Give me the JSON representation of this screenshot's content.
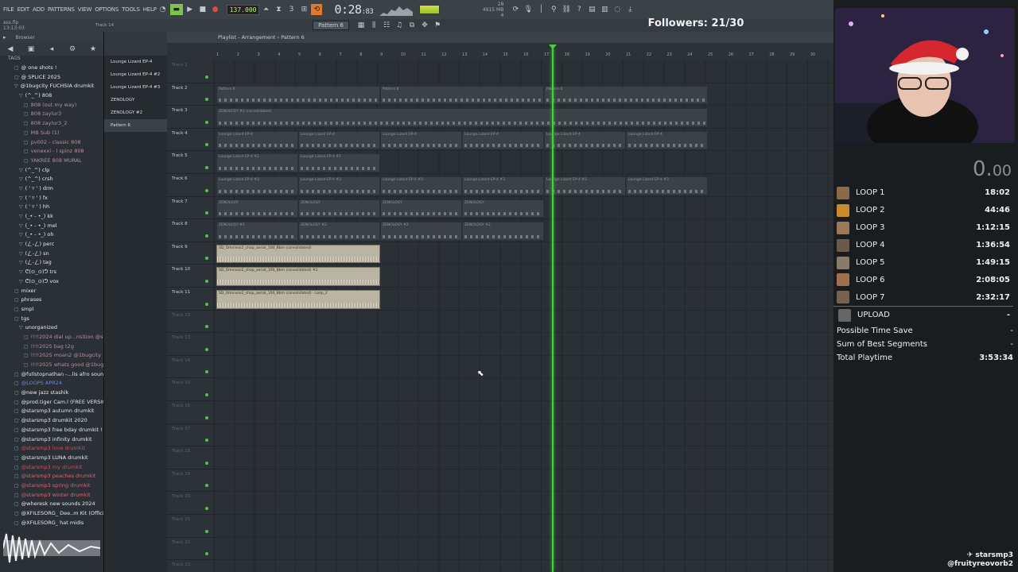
{
  "menu": [
    "FILE",
    "EDIT",
    "ADD",
    "PATTERNS",
    "VIEW",
    "OPTIONS",
    "TOOLS",
    "HELP"
  ],
  "toolbar": {
    "tempo": "137.000",
    "song_time": "0:28",
    "song_time_small": ":83",
    "memory_top": "4915 MB",
    "memory_bottom": "4",
    "cpu_value": "28"
  },
  "hint": {
    "file": "ass.flp",
    "time": "13:13:03",
    "track": "Track 14",
    "pattern": "Pattern 6",
    "snap": "Line"
  },
  "browser": {
    "title": "Browser",
    "tags_label": "TAGS",
    "items": [
      {
        "label": "@ one shots !",
        "color": "white",
        "fold": "▢"
      },
      {
        "label": "@ SPLICE 2025",
        "color": "white",
        "fold": "▢"
      },
      {
        "label": "@1bugcity FUCHSIA drumkit",
        "color": "white",
        "fold": "▽"
      },
      {
        "label": "(^_^) 808",
        "color": "white",
        "fold": "▽"
      },
      {
        "label": "808 (out my way)",
        "color": "dim",
        "fold": "▢"
      },
      {
        "label": "808 zaylur3",
        "color": "dim",
        "fold": "▢"
      },
      {
        "label": "808 zaylur3_2",
        "color": "dim",
        "fold": "▢"
      },
      {
        "label": "MB Sub (1)",
        "color": "dim",
        "fold": "▢"
      },
      {
        "label": "pv002 - classic 808",
        "color": "dim",
        "fold": "▢"
      },
      {
        "label": "venexxi - l spinz 808",
        "color": "dim",
        "fold": "▢"
      },
      {
        "label": "YAKREE 808 MURAL",
        "color": "dim",
        "fold": "▢"
      },
      {
        "label": "(^_^) clp",
        "color": "white",
        "fold": "▽"
      },
      {
        "label": "(^_^) crsh",
        "color": "white",
        "fold": "▽"
      },
      {
        "label": "( ' ▿ ' ) drm",
        "color": "white",
        "fold": "▽"
      },
      {
        "label": "( ' ▿ ' ) fx",
        "color": "white",
        "fold": "▽"
      },
      {
        "label": "( ' ▿ ' ) hh",
        "color": "white",
        "fold": "▽"
      },
      {
        "label": "(_• - •_) kk",
        "color": "white",
        "fold": "▽"
      },
      {
        "label": "(_• - •_) mel",
        "color": "white",
        "fold": "▽"
      },
      {
        "label": "(_• - •_) oh",
        "color": "white",
        "fold": "▽"
      },
      {
        "label": "(ㄥ-ㄥ) perc",
        "color": "white",
        "fold": "▽"
      },
      {
        "label": "(ㄥ-ㄥ) sn",
        "color": "white",
        "fold": "▽"
      },
      {
        "label": "(ㄥ-ㄥ) tag",
        "color": "white",
        "fold": "▽"
      },
      {
        "label": "ᕦ(⊙_⊙)ᕤ trs",
        "color": "white",
        "fold": "▽"
      },
      {
        "label": "ᕦ(⊙_⊙)ᕤ vox",
        "color": "white",
        "fold": "▽"
      },
      {
        "label": "mixer",
        "color": "white",
        "fold": "▢"
      },
      {
        "label": "phrases",
        "color": "white",
        "fold": "▢"
      },
      {
        "label": "smpl",
        "color": "white",
        "fold": "▢"
      },
      {
        "label": "tgs",
        "color": "white",
        "fold": "▢"
      },
      {
        "label": "unorganized",
        "color": "white",
        "fold": "▽"
      },
      {
        "label": "!!!!2024 dial up...nsition @starsmp3",
        "color": "dim",
        "fold": "▢"
      },
      {
        "label": "!!!!2025 bag t2g",
        "color": "dim",
        "fold": "▢"
      },
      {
        "label": "!!!!2025 moan2 @1bugcity",
        "color": "dim",
        "fold": "▢"
      },
      {
        "label": "!!!!2025 whats good @1bugcity",
        "color": "dim",
        "fold": "▢"
      },
      {
        "label": "@fullstopnathan -...lis afro sound kit",
        "color": "white",
        "fold": "▢"
      },
      {
        "label": "@LOOPS APR24",
        "color": "blue",
        "fold": "▢"
      },
      {
        "label": "@new jazz stashik",
        "color": "white",
        "fold": "▢"
      },
      {
        "label": "@prod.tiger Cam.l (FREE VERSION)",
        "color": "white",
        "fold": "▢"
      },
      {
        "label": "@starsmp3 autumn drumkit",
        "color": "white",
        "fold": "▢"
      },
      {
        "label": "@starsmp3 drumkit 2020",
        "color": "white",
        "fold": "▢"
      },
      {
        "label": "@starsmp3 free bday drumkit !",
        "color": "white",
        "fold": "▢"
      },
      {
        "label": "@starsmp3 infinity drumkit",
        "color": "white",
        "fold": "▢"
      },
      {
        "label": "@starsmp3 love drumkit",
        "color": "red",
        "fold": "▢"
      },
      {
        "label": "@starsmp3 LUNA drumkit",
        "color": "white",
        "fold": "▢"
      },
      {
        "label": "@starsmp3 my drumkit",
        "color": "red",
        "fold": "▢"
      },
      {
        "label": "@starsmp3 peaches drumkit",
        "color": "pink",
        "fold": "▢"
      },
      {
        "label": "@starsmp3 spring drumkit",
        "color": "pink",
        "fold": "▢"
      },
      {
        "label": "@starsmp3 winter drumkit",
        "color": "pink",
        "fold": "▢"
      },
      {
        "label": "@wheresk new sounds 2024",
        "color": "white",
        "fold": "▢"
      },
      {
        "label": "@XFILESORG_ Dee..m Kit (Official)",
        "color": "white",
        "fold": "▢"
      },
      {
        "label": "@XFILESORG_ hat midis",
        "color": "white",
        "fold": "▢"
      }
    ]
  },
  "picker": {
    "items": [
      "Lounge Lizard EP-4",
      "Lounge Lizard EP-4 #2",
      "Lounge Lizard EP-4 #3",
      "ZENOLOGY",
      "ZENOLOGY #2",
      "Pattern 6"
    ]
  },
  "playlist": {
    "title": "Playlist - Arrangement › Pattern 6",
    "bar_numbers": [
      "1",
      "2",
      "3",
      "4",
      "5",
      "6",
      "7",
      "8",
      "9",
      "10",
      "11",
      "12",
      "13",
      "14",
      "15",
      "16",
      "17",
      "18",
      "19",
      "20",
      "21",
      "22",
      "23",
      "24",
      "25",
      "26",
      "27",
      "28",
      "29",
      "30"
    ],
    "tracks": [
      "Track 1",
      "Track 2",
      "Track 3",
      "Track 4",
      "Track 5",
      "Track 6",
      "Track 7",
      "Track 8",
      "Track 9",
      "Track 10",
      "Track 11",
      "Track 12",
      "Track 13",
      "Track 14",
      "Track 15",
      "Track 16",
      "Track 17",
      "Track 18",
      "Track 19",
      "Track 20",
      "Track 21",
      "Track 22",
      "Track 23"
    ],
    "clips": [
      {
        "track": 1,
        "start": 0,
        "length": 8,
        "label": "Pattern 6",
        "kind": "pattern"
      },
      {
        "track": 1,
        "start": 8,
        "length": 8,
        "label": "Pattern 6",
        "kind": "pattern"
      },
      {
        "track": 1,
        "start": 16,
        "length": 8,
        "label": "Pattern 6",
        "kind": "pattern"
      },
      {
        "track": 2,
        "start": 0,
        "length": 24,
        "label": "ZENOLOGY #2 (consolidated)",
        "kind": "pattern"
      },
      {
        "track": 3,
        "start": 0,
        "length": 4,
        "label": "Lounge Lizard EP-4",
        "kind": "pattern"
      },
      {
        "track": 3,
        "start": 4,
        "length": 4,
        "label": "Lounge Lizard EP-4",
        "kind": "pattern"
      },
      {
        "track": 3,
        "start": 8,
        "length": 4,
        "label": "Lounge Lizard EP-4",
        "kind": "pattern"
      },
      {
        "track": 3,
        "start": 12,
        "length": 4,
        "label": "Lounge Lizard EP-4",
        "kind": "pattern"
      },
      {
        "track": 3,
        "start": 16,
        "length": 4,
        "label": "Lounge Lizard EP-4",
        "kind": "pattern"
      },
      {
        "track": 3,
        "start": 20,
        "length": 4,
        "label": "Lounge Lizard EP-4",
        "kind": "pattern"
      },
      {
        "track": 4,
        "start": 0,
        "length": 4,
        "label": "Lounge Lizard EP-4 #2",
        "kind": "pattern"
      },
      {
        "track": 4,
        "start": 4,
        "length": 4,
        "label": "Lounge Lizard EP-4 #2",
        "kind": "pattern"
      },
      {
        "track": 5,
        "start": 0,
        "length": 4,
        "label": "Lounge Lizard EP-4 #3",
        "kind": "pattern"
      },
      {
        "track": 5,
        "start": 4,
        "length": 4,
        "label": "Lounge Lizard EP-4 #3",
        "kind": "pattern"
      },
      {
        "track": 5,
        "start": 8,
        "length": 4,
        "label": "Lounge Lizard EP-4 #3",
        "kind": "pattern"
      },
      {
        "track": 5,
        "start": 12,
        "length": 4,
        "label": "Lounge Lizard EP-4 #3",
        "kind": "pattern"
      },
      {
        "track": 5,
        "start": 16,
        "length": 4,
        "label": "Lounge Lizard EP-4 #3",
        "kind": "pattern"
      },
      {
        "track": 5,
        "start": 20,
        "length": 4,
        "label": "Lounge Lizard EP-4 #3",
        "kind": "pattern"
      },
      {
        "track": 6,
        "start": 0,
        "length": 4,
        "label": "ZENOLOGY",
        "kind": "pattern"
      },
      {
        "track": 6,
        "start": 4,
        "length": 4,
        "label": "ZENOLOGY",
        "kind": "pattern"
      },
      {
        "track": 6,
        "start": 8,
        "length": 4,
        "label": "ZENOLOGY",
        "kind": "pattern"
      },
      {
        "track": 6,
        "start": 12,
        "length": 4,
        "label": "ZENOLOGY",
        "kind": "pattern"
      },
      {
        "track": 7,
        "start": 0,
        "length": 4,
        "label": "ZENOLOGY #2",
        "kind": "pattern"
      },
      {
        "track": 7,
        "start": 4,
        "length": 4,
        "label": "ZENOLOGY #2",
        "kind": "pattern"
      },
      {
        "track": 7,
        "start": 8,
        "length": 4,
        "label": "ZENOLOGY #2",
        "kind": "pattern"
      },
      {
        "track": 7,
        "start": 12,
        "length": 4,
        "label": "ZENOLOGY #2",
        "kind": "pattern"
      },
      {
        "track": 8,
        "start": 0,
        "length": 8,
        "label": "SD_Omnivox2_chop_aerial_100_Bbm (consolidated)",
        "kind": "audio"
      },
      {
        "track": 9,
        "start": 0,
        "length": 8,
        "label": "SD_Omnivox2_chop_aerial_100_Bbm (consolidated) #2",
        "kind": "audio"
      },
      {
        "track": 10,
        "start": 0,
        "length": 8,
        "label": "SD_Omnivox2_chop_aerial_100_Bbm (consolidated) - Loop_2",
        "kind": "audio"
      }
    ]
  },
  "stream": {
    "followers": "Followers: 21/30",
    "timer_main": "0.",
    "timer_small": "00",
    "splits": [
      {
        "name": "LOOP 1",
        "time": "18:02",
        "color": "#8a6a4a"
      },
      {
        "name": "LOOP 2",
        "time": "44:46",
        "color": "#c88a2a"
      },
      {
        "name": "LOOP 3",
        "time": "1:12:15",
        "color": "#9a7a5a"
      },
      {
        "name": "LOOP 4",
        "time": "1:36:54",
        "color": "#6a5a4a"
      },
      {
        "name": "LOOP 5",
        "time": "1:49:15",
        "color": "#8a7a6a"
      },
      {
        "name": "LOOP 6",
        "time": "2:08:05",
        "color": "#a07050"
      },
      {
        "name": "LOOP 7",
        "time": "2:32:17",
        "color": "#7a6050"
      }
    ],
    "upload": {
      "name": "UPLOAD",
      "time": "-"
    },
    "possible_time_save": {
      "label": "Possible Time Save",
      "value": "-"
    },
    "sum_of_best": {
      "label": "Sum of Best Segments",
      "value": "-"
    },
    "total_playtime": {
      "label": "Total Playtime",
      "value": "3:53:34"
    },
    "credit_1": "starsmp3",
    "credit_2": "@fruityreovorb2"
  }
}
